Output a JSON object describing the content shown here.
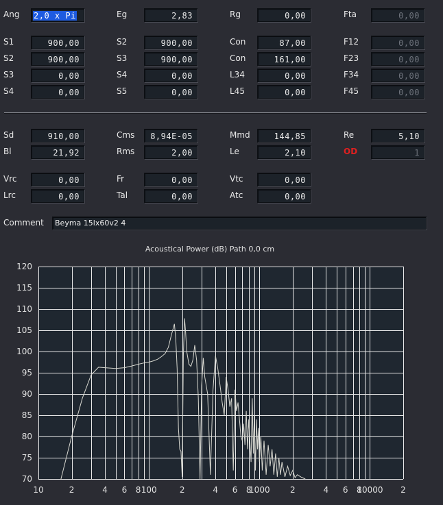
{
  "fields": {
    "ang": {
      "label": "Ang",
      "value": "2,0 x Pi"
    },
    "eg": {
      "label": "Eg",
      "value": "2,83"
    },
    "rg": {
      "label": "Rg",
      "value": "0,00"
    },
    "fta": {
      "label": "Fta",
      "value": "0,00"
    },
    "s1": {
      "label": "S1",
      "value": "900,00"
    },
    "s2a": {
      "label": "S2",
      "value": "900,00"
    },
    "con1": {
      "label": "Con",
      "value": "87,00"
    },
    "f12": {
      "label": "F12",
      "value": "0,00"
    },
    "s2b": {
      "label": "S2",
      "value": "900,00"
    },
    "s3a": {
      "label": "S3",
      "value": "900,00"
    },
    "con2": {
      "label": "Con",
      "value": "161,00"
    },
    "f23": {
      "label": "F23",
      "value": "0,00"
    },
    "s3b": {
      "label": "S3",
      "value": "0,00"
    },
    "s4a": {
      "label": "S4",
      "value": "0,00"
    },
    "l34": {
      "label": "L34",
      "value": "0,00"
    },
    "f34": {
      "label": "F34",
      "value": "0,00"
    },
    "s4b": {
      "label": "S4",
      "value": "0,00"
    },
    "s5": {
      "label": "S5",
      "value": "0,00"
    },
    "l45": {
      "label": "L45",
      "value": "0,00"
    },
    "f45": {
      "label": "F45",
      "value": "0,00"
    },
    "sd": {
      "label": "Sd",
      "value": "910,00"
    },
    "cms": {
      "label": "Cms",
      "value": "8,94E-05"
    },
    "mmd": {
      "label": "Mmd",
      "value": "144,85"
    },
    "re": {
      "label": "Re",
      "value": "5,10"
    },
    "bl": {
      "label": "Bl",
      "value": "21,92"
    },
    "rms": {
      "label": "Rms",
      "value": "2,00"
    },
    "le": {
      "label": "Le",
      "value": "2,10"
    },
    "od": {
      "label": "OD",
      "value": "1"
    },
    "vrc": {
      "label": "Vrc",
      "value": "0,00"
    },
    "fr": {
      "label": "Fr",
      "value": "0,00"
    },
    "vtc": {
      "label": "Vtc",
      "value": "0,00"
    },
    "lrc": {
      "label": "Lrc",
      "value": "0,00"
    },
    "tal": {
      "label": "Tal",
      "value": "0,00"
    },
    "atc": {
      "label": "Atc",
      "value": "0,00"
    }
  },
  "comment": {
    "label": "Comment",
    "value": "Beyma 15lx60v2 4"
  },
  "colors": {
    "background": "#2b2c33",
    "field": "#1c2229",
    "plot": "#1f2730",
    "grid": "#e8e8e8",
    "curve": "#d8d8d0",
    "od_label": "#e02020",
    "selection": "#1e5be0"
  },
  "chart_data": {
    "type": "line",
    "title": "Acoustical Power (dB)   Path 0,0 cm",
    "x_scale": "log",
    "xlim": [
      10,
      20000
    ],
    "ylim": [
      70,
      120
    ],
    "grid": true,
    "x_tick_labels": [
      {
        "v": 10,
        "t": "10"
      },
      {
        "v": 20,
        "t": "2"
      },
      {
        "v": 40,
        "t": "4"
      },
      {
        "v": 60,
        "t": "6"
      },
      {
        "v": 80,
        "t": "8"
      },
      {
        "v": 100,
        "t": "100"
      },
      {
        "v": 200,
        "t": "2"
      },
      {
        "v": 400,
        "t": "4"
      },
      {
        "v": 600,
        "t": "6"
      },
      {
        "v": 800,
        "t": "8"
      },
      {
        "v": 1000,
        "t": "1000"
      },
      {
        "v": 2000,
        "t": "2"
      },
      {
        "v": 4000,
        "t": "4"
      },
      {
        "v": 6000,
        "t": "6"
      },
      {
        "v": 8000,
        "t": "8"
      },
      {
        "v": 10000,
        "t": "10000"
      },
      {
        "v": 20000,
        "t": "2"
      }
    ],
    "y_ticks": [
      70,
      75,
      80,
      85,
      90,
      95,
      100,
      105,
      110,
      115,
      120
    ],
    "series": [
      {
        "x": [
          16,
          20,
          25,
          30,
          35,
          40,
          50,
          60,
          70,
          80,
          90,
          100,
          110,
          120,
          130,
          140,
          150,
          160,
          170,
          175,
          180,
          185,
          190,
          195,
          200,
          205,
          210,
          215,
          220,
          230,
          240,
          250,
          260,
          270,
          280,
          290,
          300,
          310,
          320,
          340,
          360,
          380,
          400,
          420,
          440,
          460,
          480,
          500,
          520,
          540,
          560,
          580,
          600,
          620,
          640,
          660,
          680,
          700,
          720,
          740,
          760,
          780,
          800,
          820,
          840,
          860,
          880,
          900,
          920,
          940,
          960,
          980,
          1000,
          1030,
          1060,
          1100,
          1150,
          1200,
          1250,
          1300,
          1350,
          1400,
          1450,
          1500,
          1550,
          1600,
          1700,
          1800,
          1900,
          2000,
          2100,
          2200,
          2400,
          2600
        ],
        "y": [
          70,
          80,
          89,
          94.5,
          96.3,
          96.2,
          96,
          96.2,
          96.6,
          97,
          97.3,
          97.5,
          97.8,
          98.2,
          98.8,
          99.5,
          101,
          104,
          106.5,
          103,
          96,
          82,
          77,
          76.5,
          70.5,
          99,
          107.8,
          104.5,
          100,
          97,
          96.5,
          98,
          101.5,
          98,
          89,
          70,
          92,
          98.5,
          94,
          90,
          71,
          91,
          99,
          96,
          92,
          88,
          85,
          94,
          91,
          87,
          89,
          72,
          91,
          86,
          88,
          84,
          80,
          79,
          83,
          78,
          86,
          77,
          84,
          79,
          74,
          89,
          76,
          85,
          72,
          84,
          77,
          82,
          74,
          80,
          72,
          79,
          71,
          78,
          73,
          77,
          71,
          76,
          70.5,
          75,
          71,
          74,
          70.5,
          73,
          70.8,
          72,
          70.3,
          71,
          70.4,
          70
        ]
      }
    ]
  }
}
